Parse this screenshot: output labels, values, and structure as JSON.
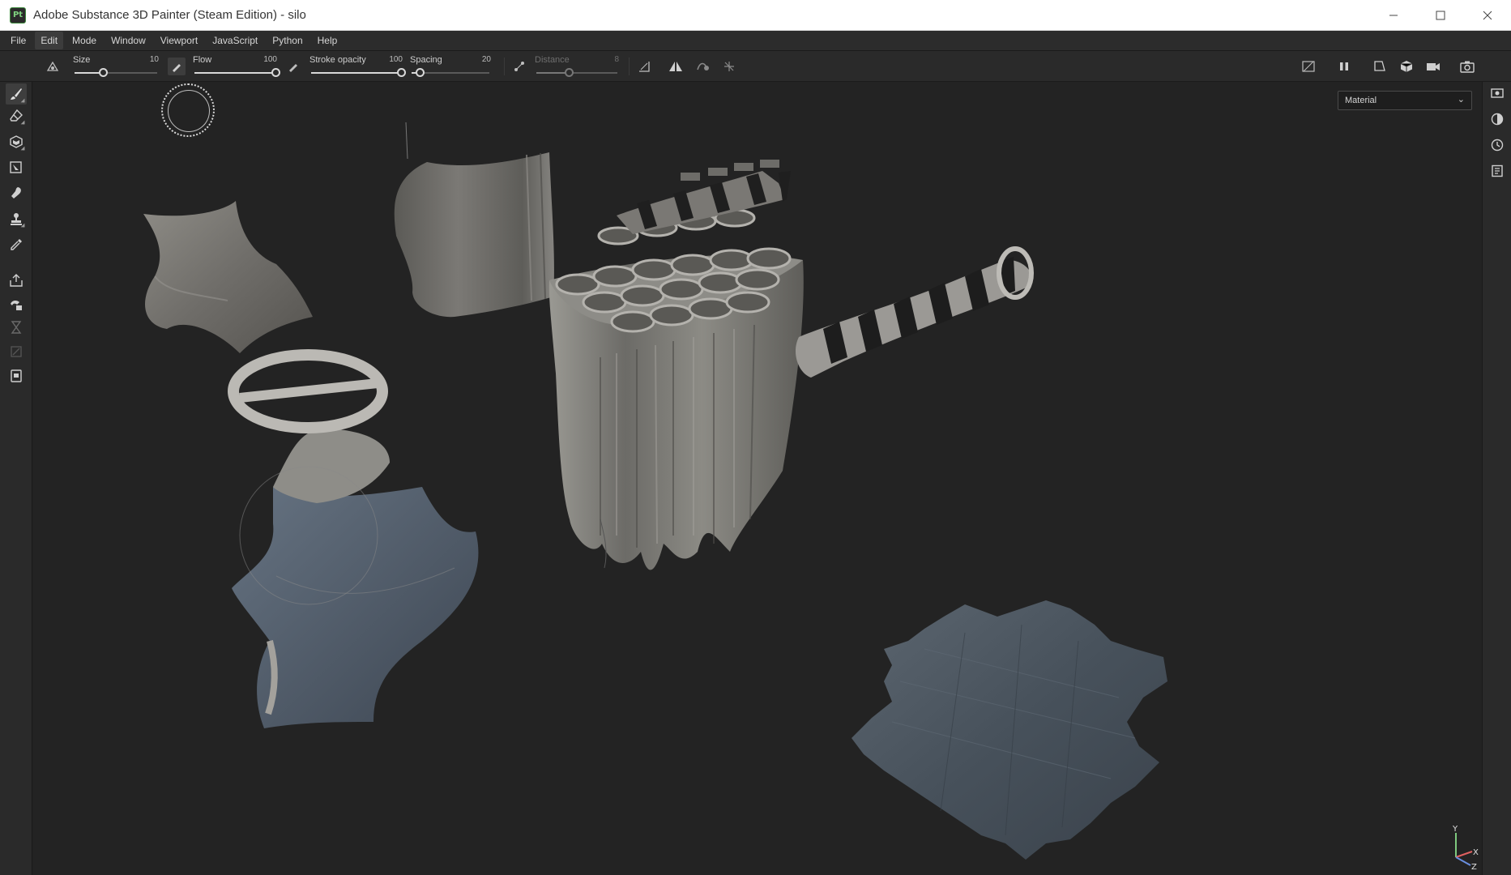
{
  "window": {
    "app_logo": "Pt",
    "title": "Adobe Substance 3D Painter (Steam Edition) - silo",
    "controls": [
      "minimize",
      "maximize",
      "close"
    ]
  },
  "menu": {
    "items": [
      "File",
      "Edit",
      "Mode",
      "Window",
      "Viewport",
      "JavaScript",
      "Python",
      "Help"
    ],
    "active": "Edit"
  },
  "tool_options": {
    "size": {
      "label": "Size",
      "value": "10",
      "fraction": 0.34
    },
    "flow": {
      "label": "Flow",
      "value": "100",
      "fraction": 1.0
    },
    "stroke_opacity": {
      "label": "Stroke opacity",
      "value": "100",
      "fraction": 1.0
    },
    "spacing": {
      "label": "Spacing",
      "value": "20",
      "fraction": 0.1
    },
    "distance": {
      "label": "Distance",
      "value": "8",
      "fraction": 0.4,
      "disabled": true
    }
  },
  "viewport": {
    "mode_select": "Material",
    "axes": {
      "y": "Y",
      "x": "X",
      "z": "Z"
    }
  },
  "left_tools": [
    "paint-brush-icon",
    "eraser-icon",
    "projection-icon",
    "polygon-fill-icon",
    "smudge-icon",
    "clone-stamp-icon",
    "color-picker-icon",
    "bake-icon",
    "material-picker-icon",
    "geometry-mask-icon",
    "transform-icon",
    "auto-unwrap-icon"
  ],
  "right_tools": [
    "display-settings-icon",
    "shader-settings-icon",
    "history-icon",
    "log-icon"
  ]
}
